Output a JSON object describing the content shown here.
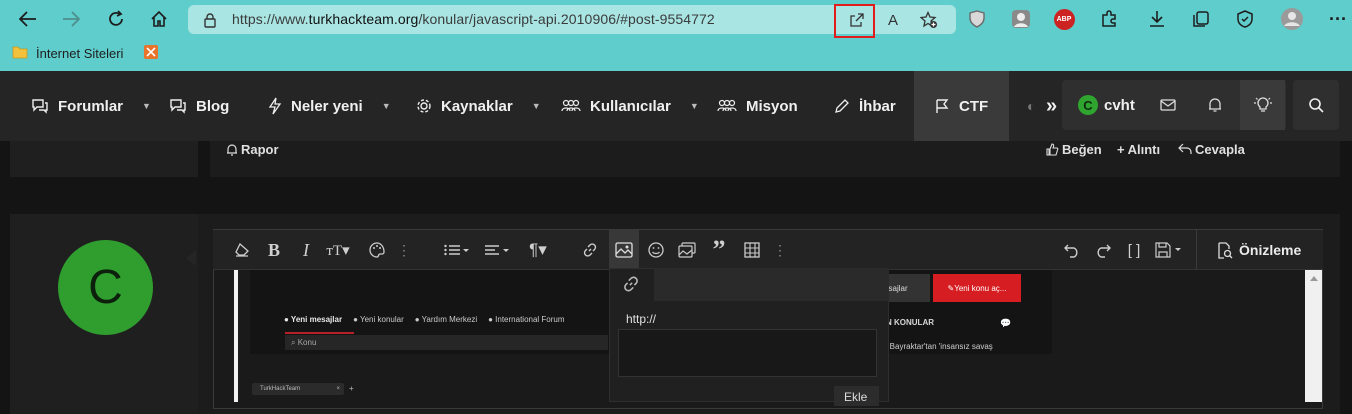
{
  "browser": {
    "url_prefix": "https://www.",
    "url_domain": "turkhackteam.org",
    "url_path": "/konular/javascript-api.2010906/#post-9554772",
    "read_aloud": "A",
    "bookmark_label": "İnternet Siteleri",
    "ext_abp": "ABP"
  },
  "nav": {
    "items": [
      "Forumlar",
      "Blog",
      "Neler yeni",
      "Kaynaklar",
      "Kullanıcılar",
      "Misyon",
      "İhbar",
      "CTF"
    ],
    "more_icon": "»",
    "user": {
      "avatar_letter": "C",
      "name": "cvht"
    }
  },
  "post": {
    "report": "Rapor",
    "like": "Beğen",
    "quote": "Alıntı",
    "reply": "Cevapla"
  },
  "reply": {
    "avatar_letter": "C",
    "preview": "Önizleme",
    "insert_link_label": "http://",
    "insert_button": "Ekle"
  },
  "embedded": {
    "tabs": [
      "Yeni mesajlar",
      "Yeni konular",
      "Yardım Merkezi",
      "International Forum"
    ],
    "search_placeholder": "Konu",
    "right_btn1": "mesajlar",
    "right_btn2": "Yeni konu aç...",
    "right_heading": "N KONULAR",
    "right_item": "çuk Bayraktar'tan 'insansız savaş",
    "mini_tab": "TurkHackTeam"
  },
  "colors": {
    "browser_bg": "#5fcdcb",
    "nav_bg": "#252525",
    "avatar_green": "#2f9e2f",
    "highlight_red": "#e21b1b",
    "new_thread_red": "#d51d22"
  }
}
